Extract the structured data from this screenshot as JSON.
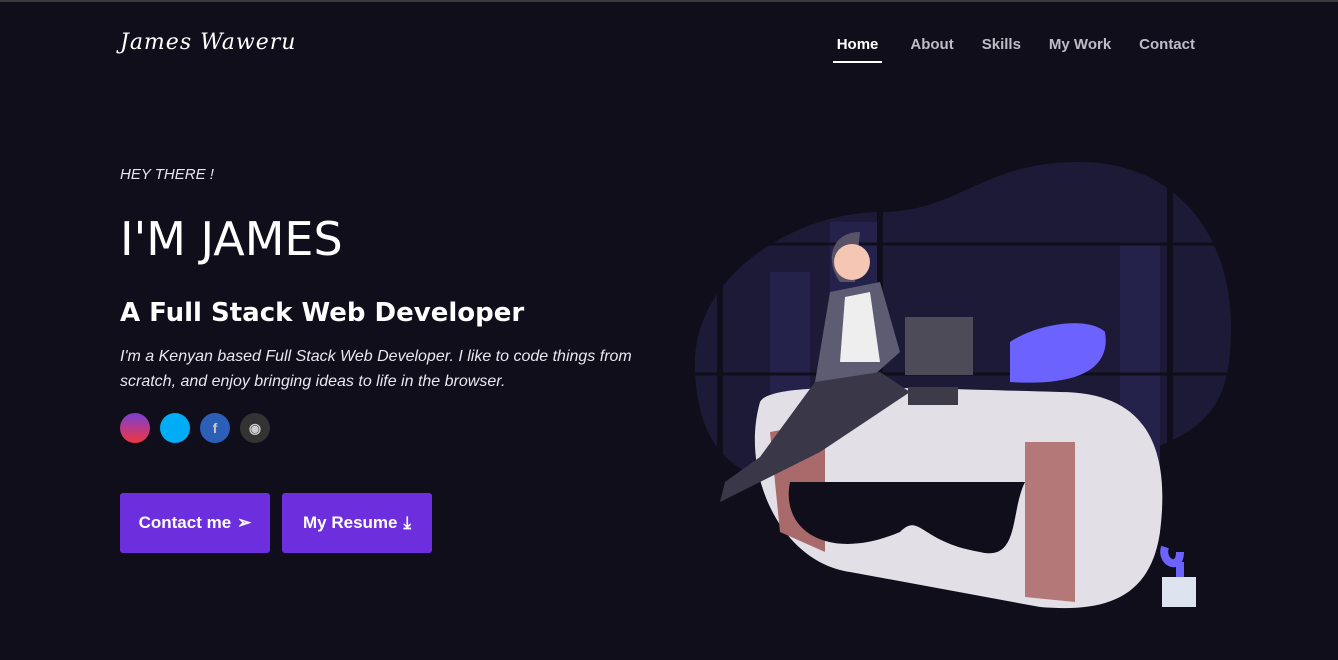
{
  "header": {
    "logo": "James Waweru",
    "nav": [
      {
        "label": "Home",
        "active": true
      },
      {
        "label": "About"
      },
      {
        "label": "Skills"
      },
      {
        "label": "My Work"
      },
      {
        "label": "Contact"
      }
    ]
  },
  "hero": {
    "greeting": "HEY THERE !",
    "title": "I'M JAMES",
    "subtitle": "A Full Stack Web Developer",
    "description": "I'm a Kenyan based Full Stack Web Developer. I like to code things from scratch, and enjoy bringing ideas to life in the browser.",
    "social": [
      {
        "icon": "instagram-icon"
      },
      {
        "icon": "twitter-icon"
      },
      {
        "icon": "facebook-icon",
        "glyph": "f"
      },
      {
        "icon": "github-icon",
        "glyph": "◉"
      }
    ],
    "buttons": {
      "contact": "Contact me",
      "contact_icon": "➢",
      "resume": "My Resume",
      "resume_icon": "⤓"
    }
  },
  "colors": {
    "background": "#100e1b",
    "accent": "#6d2fde"
  }
}
